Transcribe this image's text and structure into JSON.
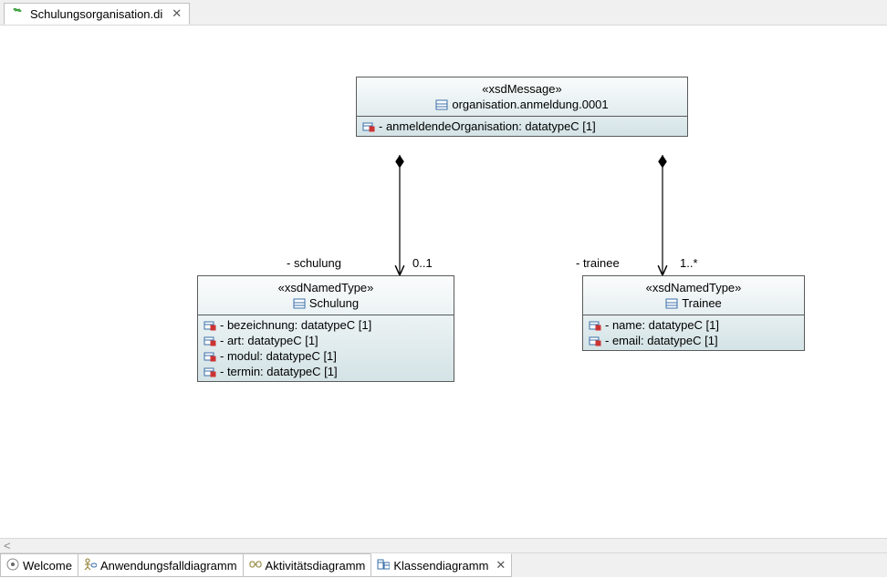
{
  "top_tab": {
    "label": "Schulungsorganisation.di"
  },
  "diagram": {
    "msg": {
      "stereo": "«xsdMessage»",
      "name": "organisation.anmeldung.0001",
      "attrs": [
        "- anmeldendeOrganisation: datatypeC [1]"
      ]
    },
    "schulung": {
      "stereo": "«xsdNamedType»",
      "name": "Schulung",
      "attrs": [
        "- bezeichnung: datatypeC [1]",
        "- art: datatypeC [1]",
        "- modul: datatypeC [1]",
        "- termin: datatypeC [1]"
      ]
    },
    "trainee": {
      "stereo": "«xsdNamedType»",
      "name": "Trainee",
      "attrs": [
        "- name: datatypeC [1]",
        "- email: datatypeC [1]"
      ]
    },
    "assoc_schulung": {
      "role": "- schulung",
      "mult": "0..1"
    },
    "assoc_trainee": {
      "role": "- trainee",
      "mult": "1..*"
    }
  },
  "bottom_tabs": {
    "welcome": "Welcome",
    "anwendungsfall": "Anwendungsfalldiagramm",
    "aktivitaet": "Aktivitätsdiagramm",
    "klassen": "Klassendiagramm"
  }
}
